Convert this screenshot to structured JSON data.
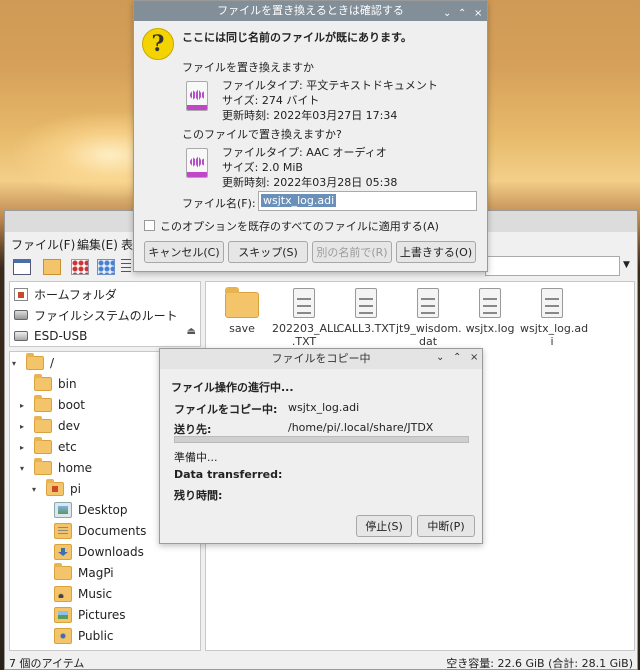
{
  "colors": {
    "dialog_title_bar": "#828f99",
    "warning_icon": "#f4d400",
    "audio_icon_accent": "#c048c8",
    "folder": "#f4c46a"
  },
  "replace_dialog": {
    "title": "ファイルを置き換えるときは確認する",
    "message": "ここには同じ名前のファイルが既にあります。",
    "replace_question": "ファイルを置き換えますか",
    "existing": {
      "type": "ファイルタイプ: 平文テキストドキュメント",
      "size": "サイズ: 274 バイト",
      "modified": "更新時刻: 2022年03月27日 17:34"
    },
    "with_question": "このファイルで置き換えますか?",
    "new_file": {
      "type": "ファイルタイプ: AAC オーディオ",
      "size": "サイズ: 2.0 MiB",
      "modified": "更新時刻: 2022年03月28日 05:38"
    },
    "filename_label": "ファイル名(F):",
    "filename_value": "wsjtx_log.adi",
    "apply_all_label": "このオプションを既存のすべてのファイルに適用する(A)",
    "buttons": {
      "cancel": "キャンセル(C)",
      "skip": "スキップ(S)",
      "rename": "別の名前で(R)",
      "overwrite": "上書きする(O)"
    },
    "controls": {
      "minimize": "⌄",
      "maximize": "⌃",
      "close": "×"
    }
  },
  "file_manager": {
    "menu": {
      "file": "ファイル(F)",
      "edit": "編集(E)",
      "view": "表"
    },
    "places": [
      {
        "label": "ホームフォルダ",
        "icon": "home-icon"
      },
      {
        "label": "ファイルシステムのルート",
        "icon": "drive-icon"
      },
      {
        "label": "ESD-USB",
        "icon": "usb-drive-icon"
      }
    ],
    "eject_icon": "⏏",
    "tree": {
      "root": "/",
      "children": [
        "bin",
        "boot",
        "dev",
        "etc",
        "home"
      ],
      "home_children": [
        "pi"
      ],
      "pi_children": [
        "Desktop",
        "Documents",
        "Downloads",
        "MagPi",
        "Music",
        "Pictures",
        "Public"
      ]
    },
    "files": [
      {
        "name": "save",
        "kind": "folder"
      },
      {
        "name": "202203_ALL\n.TXT",
        "kind": "text"
      },
      {
        "name": "CALL3.TXT",
        "kind": "text"
      },
      {
        "name": "jt9_wisdom.\ndat",
        "kind": "text"
      },
      {
        "name": "wsjtx.log",
        "kind": "text"
      },
      {
        "name": "wsjtx_log.ad\ni",
        "kind": "text"
      }
    ],
    "status_left": "7 個のアイテム",
    "status_right": "空き容量: 22.6 GiB (合計: 28.1 GiB)"
  },
  "copy_dialog": {
    "title": "ファイルをコピー中",
    "heading": "ファイル操作の進行中...",
    "copying_label": "ファイルをコピー中:",
    "copying_value": "wsjtx_log.adi",
    "dest_label": "送り先:",
    "dest_value": "/home/pi/.local/share/JTDX",
    "progress": 0.0,
    "status_text": "準備中...",
    "data_label": "Data transferred:",
    "remaining_label": "残り時間:",
    "buttons": {
      "pause": "停止(S)",
      "cancel": "中断(P)"
    },
    "controls": {
      "minimize": "⌄",
      "maximize": "⌃",
      "close": "×"
    }
  }
}
